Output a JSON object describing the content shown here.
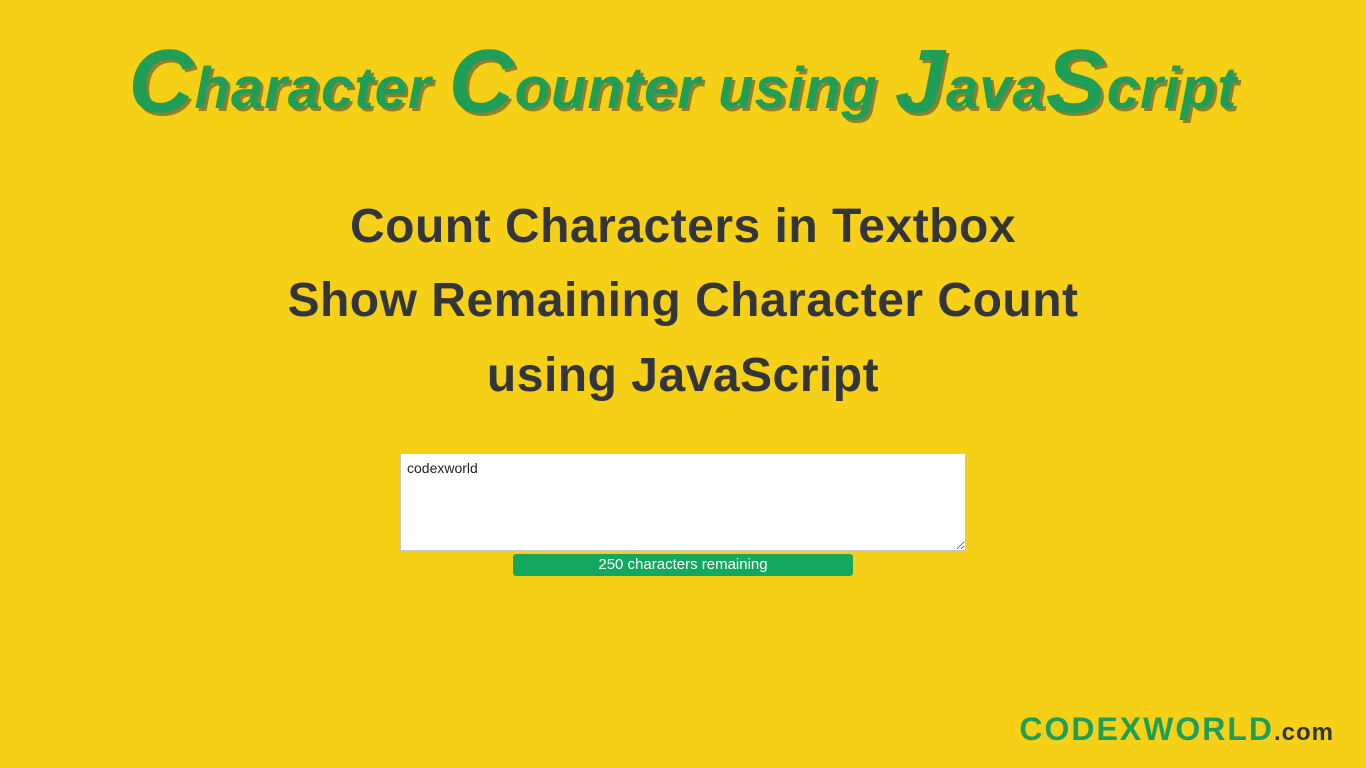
{
  "title": {
    "c1": "C",
    "w1": "haracter ",
    "c2": "C",
    "w2": "ounter using ",
    "c3": "J",
    "w3": "ava",
    "c4": "S",
    "w4": "cript"
  },
  "subtitle": {
    "line1": "Count Characters in Textbox",
    "line2": "Show Remaining Character Count",
    "line3": "using JavaScript"
  },
  "demo": {
    "textarea_value": "codexworld",
    "counter_text": "250 characters remaining"
  },
  "watermark": {
    "brand": "CODEXWORLD",
    "ext": ".com"
  }
}
